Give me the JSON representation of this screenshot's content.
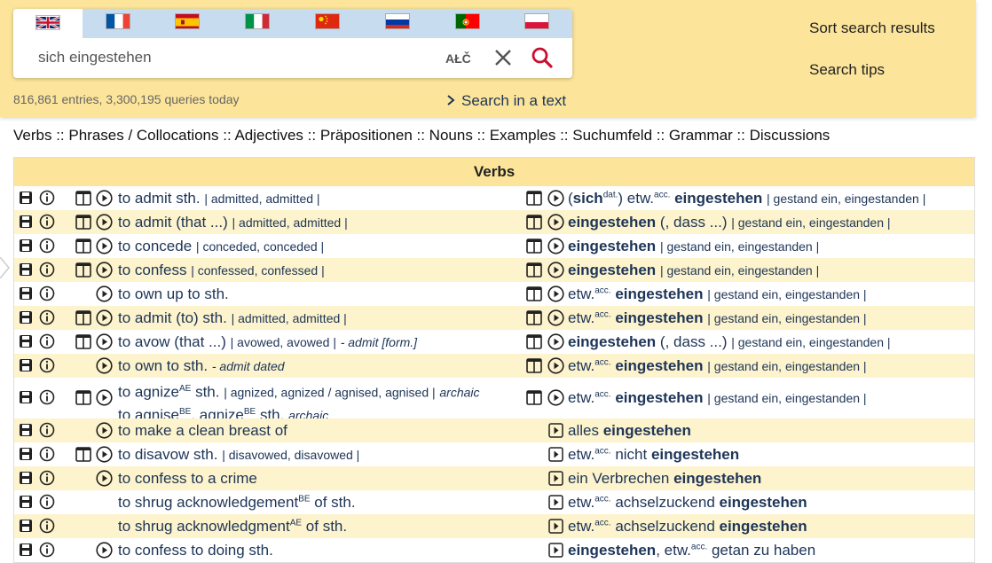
{
  "languages": [
    {
      "name": "English",
      "flag": "gb-flag-icon"
    },
    {
      "name": "French",
      "flag": "fr-flag-icon"
    },
    {
      "name": "Spanish",
      "flag": "es-flag-icon"
    },
    {
      "name": "Italian",
      "flag": "it-flag-icon"
    },
    {
      "name": "Chinese",
      "flag": "cn-flag-icon"
    },
    {
      "name": "Russian",
      "flag": "ru-flag-icon"
    },
    {
      "name": "Portuguese",
      "flag": "pt-flag-icon"
    },
    {
      "name": "Polish",
      "flag": "pl-flag-icon"
    }
  ],
  "search": {
    "value": "sich eingestehen",
    "special_chars": "AŁČ"
  },
  "stats": "816,861 entries, 3,300,195 queries today",
  "search_in_text": "Search in a text",
  "sort_results": "Sort search results",
  "search_tips": "Search tips",
  "categories": "Verbs :: Phrases / Collocations :: Adjectives :: Präpositionen :: Nouns :: Examples :: Suchumfeld :: Grammar :: Discussions",
  "table_title": "Verbs",
  "rows": [
    {
      "l": "to admit sth.",
      "lg": "| admitted, admitted |",
      "r_pre": "(",
      "r_b1": "sich",
      "r_sup1": "dat.",
      "r_mid": ") etw.",
      "r_sup2": "acc.",
      "r_b2": "eingestehen",
      "r_after": "",
      "rg": "| gestand ein, eingestanden |"
    },
    {
      "l": "to admit (that ...)",
      "lg": "| admitted, admitted |",
      "r_b2": "eingestehen",
      "r_after": " (, dass ...)",
      "rg": "| gestand ein, eingestanden |"
    },
    {
      "l": "to concede",
      "lg": "| conceded, conceded |",
      "r_b2": "eingestehen",
      "rg": "| gestand ein, eingestanden |"
    },
    {
      "l": "to confess",
      "lg": "| confessed, confessed |",
      "r_b2": "eingestehen",
      "rg": "| gestand ein, eingestanden |"
    },
    {
      "l": "to own up to sth.",
      "lg": "",
      "r_mid": "etw.",
      "r_sup2": "acc.",
      "r_b2": "eingestehen",
      "rg": "| gestand ein, eingestanden |"
    },
    {
      "l": "to admit (to) sth.",
      "lg": "| admitted, admitted |",
      "r_mid": "etw.",
      "r_sup2": "acc.",
      "r_b2": "eingestehen",
      "rg": "| gestand ein, eingestanden |"
    },
    {
      "l": "to avow (that ...)",
      "lg": "| avowed, avowed |",
      "ln": "- admit [form.]",
      "r_b2": "eingestehen",
      "r_after": " (, dass ...)",
      "rg": "| gestand ein, eingestanden |"
    },
    {
      "l": "to own to sth.",
      "ln": "- admit   dated",
      "r_mid": "etw.",
      "r_sup2": "acc.",
      "r_b2": "eingestehen",
      "rg": "| gestand ein, eingestanden |"
    },
    {
      "l1": "to agnize",
      "s1": "AE",
      "l1b": " sth.",
      "lg": "| agnized, agnized / agnised, agnised |",
      "ln": "archaic",
      "l2": "to agnise",
      "s2": "BE",
      "l2b": ", agnize",
      "s3": "BE",
      "l2c": " sth.",
      "ln2": "archaic",
      "r_mid": "etw.",
      "r_sup2": "acc.",
      "r_b2": "eingestehen",
      "rg": "| gestand ein, eingestanden |"
    },
    {
      "l": "to make a clean breast of",
      "r_mid": "alles ",
      "r_b2": "eingestehen"
    },
    {
      "l": "to disavow sth.",
      "lg": "| disavowed, disavowed |",
      "r_mid": "etw.",
      "r_sup2": "acc.",
      "r_after0": " nicht ",
      "r_b2": "eingestehen"
    },
    {
      "l": "to confess to a crime",
      "r_mid": "ein Verbrechen ",
      "r_b2": "eingestehen"
    },
    {
      "l": "to shrug acknowledgement",
      "ls": "BE",
      "lb": " of sth.",
      "r_mid": "etw.",
      "r_sup2": "acc.",
      "r_after0": " achselzuckend ",
      "r_b2": "eingestehen"
    },
    {
      "l": "to shrug acknowledgment",
      "ls": "AE",
      "lb": " of sth.",
      "r_mid": "etw.",
      "r_sup2": "acc.",
      "r_after0": " achselzuckend ",
      "r_b2": "eingestehen"
    },
    {
      "l": "to confess to doing sth.",
      "r_b2": "eingestehen",
      "r_mid2": ", etw.",
      "r_sup2": "acc.",
      "r_after0": " getan zu haben"
    }
  ],
  "colors": {
    "top_bar": "#fce59a",
    "alt_row": "#fdf3cc",
    "flag_bar": "#c8dcf0",
    "link": "#1d3557",
    "search_icon": "#c8102e"
  }
}
